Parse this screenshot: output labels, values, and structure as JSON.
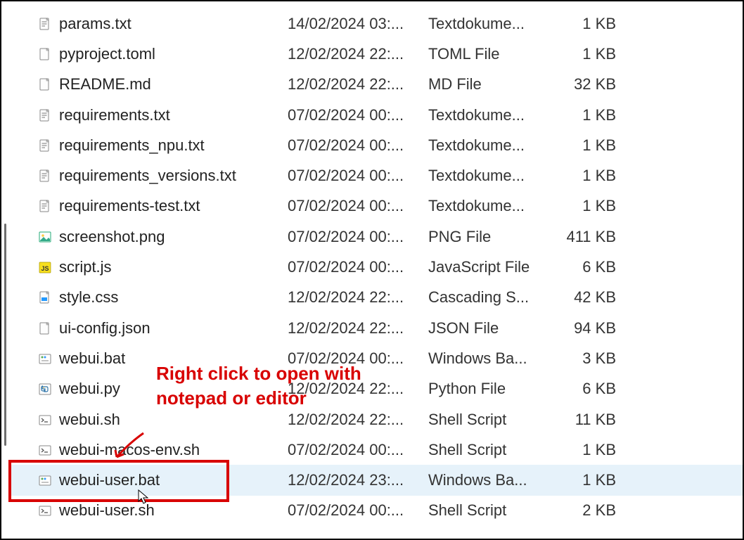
{
  "annotation": {
    "text": "Right click to open with notepad or editor"
  },
  "icons": {
    "txt": "txt-icon",
    "md": "md-icon",
    "png": "png-icon",
    "js": "js-icon",
    "css": "css-icon",
    "json": "json-icon",
    "bat": "bat-icon",
    "py": "py-icon",
    "sh": "sh-icon",
    "toml": "toml-icon"
  },
  "files": [
    {
      "name": "params.txt",
      "date": "14/02/2024 03:...",
      "type": "Textdokume...",
      "size": "1 KB",
      "icon": "txt"
    },
    {
      "name": "pyproject.toml",
      "date": "12/02/2024 22:...",
      "type": "TOML File",
      "size": "1 KB",
      "icon": "toml"
    },
    {
      "name": "README.md",
      "date": "12/02/2024 22:...",
      "type": "MD File",
      "size": "32 KB",
      "icon": "md"
    },
    {
      "name": "requirements.txt",
      "date": "07/02/2024 00:...",
      "type": "Textdokume...",
      "size": "1 KB",
      "icon": "txt"
    },
    {
      "name": "requirements_npu.txt",
      "date": "07/02/2024 00:...",
      "type": "Textdokume...",
      "size": "1 KB",
      "icon": "txt"
    },
    {
      "name": "requirements_versions.txt",
      "date": "07/02/2024 00:...",
      "type": "Textdokume...",
      "size": "1 KB",
      "icon": "txt"
    },
    {
      "name": "requirements-test.txt",
      "date": "07/02/2024 00:...",
      "type": "Textdokume...",
      "size": "1 KB",
      "icon": "txt"
    },
    {
      "name": "screenshot.png",
      "date": "07/02/2024 00:...",
      "type": "PNG File",
      "size": "411 KB",
      "icon": "png"
    },
    {
      "name": "script.js",
      "date": "07/02/2024 00:...",
      "type": "JavaScript File",
      "size": "6 KB",
      "icon": "js"
    },
    {
      "name": "style.css",
      "date": "12/02/2024 22:...",
      "type": "Cascading S...",
      "size": "42 KB",
      "icon": "css"
    },
    {
      "name": "ui-config.json",
      "date": "12/02/2024 22:...",
      "type": "JSON File",
      "size": "94 KB",
      "icon": "json"
    },
    {
      "name": "webui.bat",
      "date": "07/02/2024 00:...",
      "type": "Windows Ba...",
      "size": "3 KB",
      "icon": "bat"
    },
    {
      "name": "webui.py",
      "date": "12/02/2024 22:...",
      "type": "Python File",
      "size": "6 KB",
      "icon": "py"
    },
    {
      "name": "webui.sh",
      "date": "12/02/2024 22:...",
      "type": "Shell Script",
      "size": "11 KB",
      "icon": "sh"
    },
    {
      "name": "webui-macos-env.sh",
      "date": "07/02/2024 00:...",
      "type": "Shell Script",
      "size": "1 KB",
      "icon": "sh"
    },
    {
      "name": "webui-user.bat",
      "date": "12/02/2024 23:...",
      "type": "Windows Ba...",
      "size": "1 KB",
      "icon": "bat",
      "selected": true
    },
    {
      "name": "webui-user.sh",
      "date": "07/02/2024 00:...",
      "type": "Shell Script",
      "size": "2 KB",
      "icon": "sh"
    }
  ]
}
